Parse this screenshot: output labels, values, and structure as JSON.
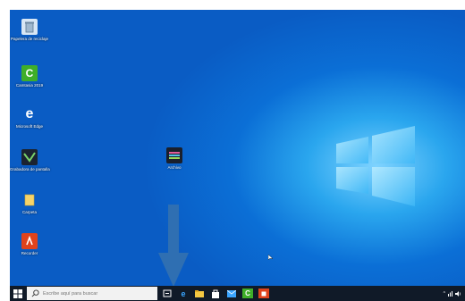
{
  "desktop": {
    "icons": [
      {
        "label": "Papelera de reciclaje",
        "icon": "recycle-bin-icon"
      },
      {
        "label": "Camtasia 2019",
        "icon": "camtasia-icon"
      },
      {
        "label": "Microsoft Edge",
        "icon": "edge-icon"
      },
      {
        "label": "Grabadora de pantalla",
        "icon": "screen-recorder-icon"
      },
      {
        "label": "Carpeta",
        "icon": "folder-icon"
      },
      {
        "label": "Recorder",
        "icon": "recorder-app-icon"
      },
      {
        "label": "Archivo",
        "icon": "file-icon"
      }
    ]
  },
  "taskbar": {
    "search_placeholder": "Escribe aquí para buscar",
    "pinned": [
      "task-view-icon",
      "edge-icon",
      "file-explorer-icon",
      "store-icon",
      "mail-icon",
      "camtasia-icon",
      "recorder-app-icon"
    ],
    "tray_icons": [
      "chevron-up-icon",
      "network-icon",
      "volume-icon"
    ]
  },
  "colors": {
    "desktop_blue": "#0a5cc4",
    "taskbar": "#101a28",
    "arrow": "#2f6fb2",
    "camtasia_green": "#3fae29",
    "recorder_orange": "#e0431c"
  }
}
